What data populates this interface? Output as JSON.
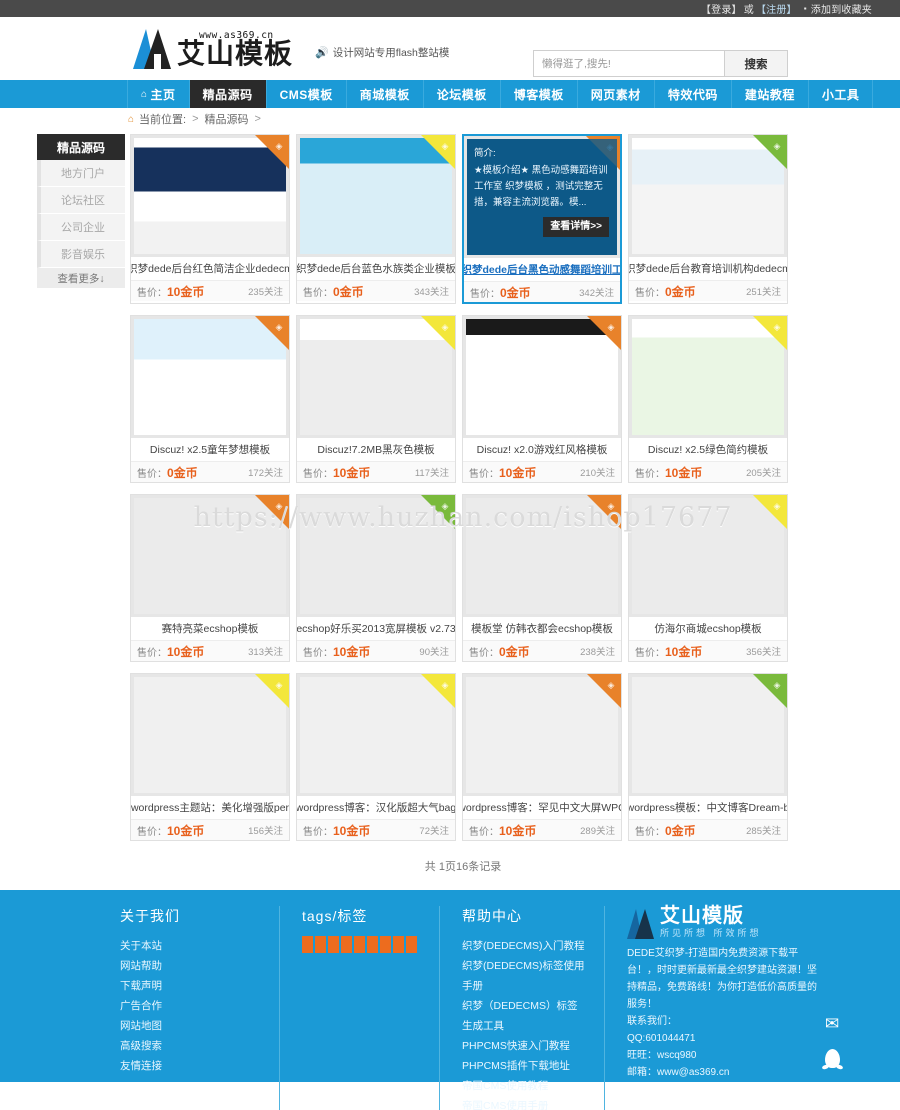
{
  "topbar": {
    "login": "【登录】",
    "or": "或",
    "register": "【注册】",
    "bullet": "▪",
    "favorite": "添加到收藏夹"
  },
  "header": {
    "logo_url": "www.as369.cn",
    "logo_name": "艾山模板",
    "tagline": "设计网站专用flash整站模",
    "horn_icon": "speaker-icon"
  },
  "search": {
    "placeholder": "懒得逛了,搜先!",
    "value": "",
    "button": "搜索",
    "icon": "search-icon"
  },
  "nav": {
    "items": [
      {
        "label": "主页",
        "icon": "home-icon",
        "active": false
      },
      {
        "label": "精品源码",
        "active": true
      },
      {
        "label": "CMS模板",
        "active": false
      },
      {
        "label": "商城模板",
        "active": false
      },
      {
        "label": "论坛模板",
        "active": false
      },
      {
        "label": "博客模板",
        "active": false
      },
      {
        "label": "网页素材",
        "active": false
      },
      {
        "label": "特效代码",
        "active": false
      },
      {
        "label": "建站教程",
        "active": false
      },
      {
        "label": "小工具",
        "active": false
      }
    ]
  },
  "breadcrumb": {
    "home_icon": "home-icon",
    "label": "当前位置:",
    "arrow1": ">",
    "current": "精品源码",
    "arrow2": ">"
  },
  "sidebar": {
    "header": "精品源码",
    "items": [
      {
        "label": "地方门户"
      },
      {
        "label": "论坛社区"
      },
      {
        "label": "公司企业"
      },
      {
        "label": "影音娱乐"
      }
    ],
    "more": "查看更多↓"
  },
  "watermark": "https://www.huzhan.com/ishop17677",
  "price_label": "售价：",
  "cards": [
    {
      "title": "织梦dede后台红色简洁企业dedecm",
      "price": "10金币",
      "attention": "235关注",
      "ribbon": "orange",
      "hovered": false
    },
    {
      "title": "织梦dede后台蓝色水族类企业模板",
      "price": "0金币",
      "attention": "343关注",
      "ribbon": "yellow",
      "hovered": false
    },
    {
      "title": "织梦dede后台黑色动感舞蹈培训工",
      "price": "0金币",
      "attention": "342关注",
      "ribbon": "orange",
      "hovered": true,
      "overlay_label": "简介:",
      "overlay_text": "★模板介绍★ 黑色动感舞蹈培训工作室 织梦模板 ，测试完整无措，兼容主流浏览器。模...",
      "overlay_button": "查看详情>>"
    },
    {
      "title": "织梦dede后台教育培训机构dedecm",
      "price": "0金币",
      "attention": "251关注",
      "ribbon": "green",
      "hovered": false
    },
    {
      "title": "Discuz! x2.5童年梦想模板",
      "price": "0金币",
      "attention": "172关注",
      "ribbon": "orange",
      "hovered": false
    },
    {
      "title": "Discuz!7.2MB黑灰色模板",
      "price": "10金币",
      "attention": "117关注",
      "ribbon": "yellow",
      "hovered": false
    },
    {
      "title": "Discuz! x2.0游戏红风格模板",
      "price": "10金币",
      "attention": "210关注",
      "ribbon": "orange",
      "hovered": false
    },
    {
      "title": "Discuz! x2.5绿色简约模板",
      "price": "10金币",
      "attention": "205关注",
      "ribbon": "yellow",
      "hovered": false
    },
    {
      "title": "赛特亮菜ecshop模板",
      "price": "10金币",
      "attention": "313关注",
      "ribbon": "orange",
      "hovered": false
    },
    {
      "title": "ecshop好乐买2013宽屏模板 v2.73",
      "price": "10金币",
      "attention": "90关注",
      "ribbon": "green",
      "hovered": false
    },
    {
      "title": "模板堂 仿韩衣都会ecshop模板",
      "price": "0金币",
      "attention": "238关注",
      "ribbon": "orange",
      "hovered": false
    },
    {
      "title": "仿海尔商城ecshop模板",
      "price": "10金币",
      "attention": "356关注",
      "ribbon": "yellow",
      "hovered": false
    },
    {
      "title": "wordpress主题站：美化增强版per",
      "price": "10金币",
      "attention": "156关注",
      "ribbon": "yellow",
      "hovered": false
    },
    {
      "title": "wordpress博客：汉化版超大气bag",
      "price": "10金币",
      "attention": "72关注",
      "ribbon": "yellow",
      "hovered": false
    },
    {
      "title": "wordpress博客：罕见中文大屏WPC",
      "price": "10金币",
      "attention": "289关注",
      "ribbon": "orange",
      "hovered": false
    },
    {
      "title": "wordpress模板：中文博客Dream-b",
      "price": "0金币",
      "attention": "285关注",
      "ribbon": "green",
      "hovered": false
    }
  ],
  "pagination": {
    "text": "共 1页16条记录"
  },
  "footer": {
    "col1": {
      "head": "关于我们",
      "links": [
        "关于本站",
        "网站帮助",
        "下载声明",
        "广告合作",
        "网站地图",
        "高级搜索",
        "友情连接"
      ]
    },
    "col2": {
      "head": "tags/标签",
      "tag_count": 9
    },
    "col3": {
      "head": "帮助中心",
      "links": [
        "织梦(DEDECMS)入门教程",
        "织梦(DEDECMS)标签使用手册",
        "织梦（DEDECMS）标签生成工具",
        "PHPCMS快速入门教程",
        "PHPCMS插件下载地址",
        "帝国CMS使用教程",
        "帝国CMS使用手册"
      ]
    },
    "col4": {
      "logo_name": "艾山模版",
      "logo_sub": "所见所想 所效所想",
      "desc": "DEDE艾织梦-打造国内免费资源下载平台！，时时更新最新最全织梦建站资源！坚持精品，免费路线！为你打造低价高质量的服务！",
      "contact_label": "联系我们：",
      "qq": "QQ:601044471",
      "wangwang": "旺旺：wscq980",
      "email": "邮箱：www@as369.cn"
    },
    "float": {
      "mail_icon": "mail-icon",
      "qq_icon": "qq-icon"
    }
  },
  "colors": {
    "brand_blue": "#1b9ad6",
    "accent_orange": "#e8601c",
    "dark": "#2b2b2b",
    "ribbon_green": "#7aba3c",
    "ribbon_yellow": "#f3e73b"
  }
}
